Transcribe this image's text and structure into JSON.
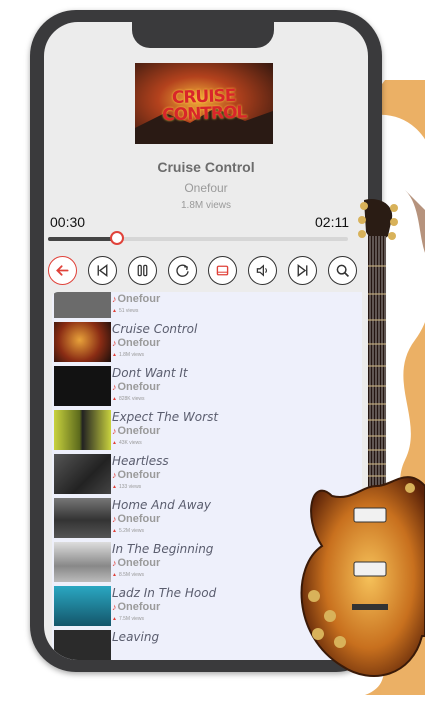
{
  "now_playing": {
    "cover_text": "CRUISE CONTROL",
    "title": "Cruise Control",
    "artist": "Onefour",
    "views": "1.8M views",
    "elapsed": "00:30",
    "duration": "02:11",
    "progress": 0.23
  },
  "controls": [
    "back-icon",
    "previous-icon",
    "pause-icon",
    "repeat-icon",
    "playlist-icon",
    "volume-icon",
    "next-icon",
    "search-icon"
  ],
  "colors": {
    "accent": "#e0423a",
    "guitar_body": "#c8701e",
    "splash": "#e8a24a"
  },
  "playlist": [
    {
      "title": "",
      "artist": "Onefour",
      "views": "51 views",
      "thumb": "#6b6b6b"
    },
    {
      "title": "Cruise Control",
      "artist": "Onefour",
      "views": "1.8M views",
      "thumb": "#2a1a10"
    },
    {
      "title": "Dont Want It",
      "artist": "Onefour",
      "views": "828K views",
      "thumb": "#111111"
    },
    {
      "title": "Expect The Worst",
      "artist": "Onefour",
      "views": "43K views",
      "thumb": "#b9c43a"
    },
    {
      "title": "Heartless",
      "artist": "Onefour",
      "views": "133 views",
      "thumb": "#3b3b3b"
    },
    {
      "title": "Home And Away",
      "artist": "Onefour",
      "views": "5.2M views",
      "thumb": "#555555"
    },
    {
      "title": "In The Beginning",
      "artist": "Onefour",
      "views": "8.5M views",
      "thumb": "#9a9a9a"
    },
    {
      "title": "Ladz In The Hood",
      "artist": "Onefour",
      "views": "7.5M views",
      "thumb": "#1f8fa6"
    },
    {
      "title": "Leaving",
      "artist": "",
      "views": "",
      "thumb": "#2b2b2b"
    }
  ]
}
